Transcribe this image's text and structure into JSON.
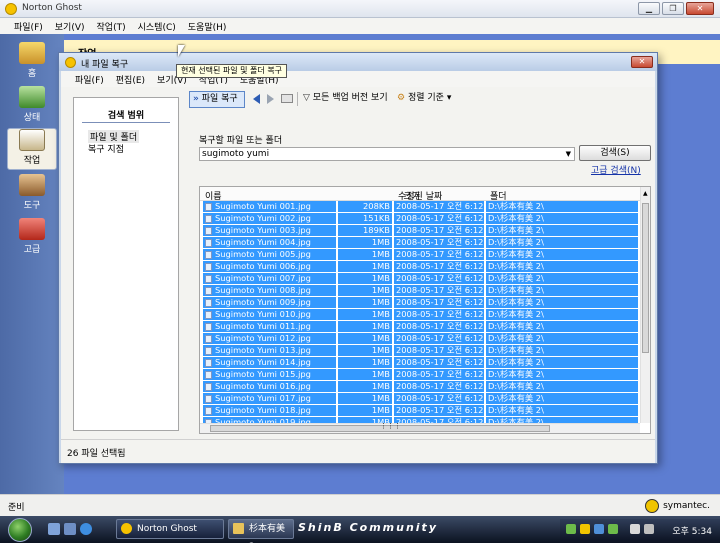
{
  "app": {
    "title": "Norton Ghost",
    "menu": [
      "파일(F)",
      "보기(V)",
      "작업(T)",
      "시스템(C)",
      "도움말(H)"
    ],
    "header_title": "작업",
    "status": "준비",
    "brand": "symantec."
  },
  "sidebar": {
    "items": [
      {
        "label": "홈",
        "icon": "home-icon",
        "active": false
      },
      {
        "label": "상태",
        "icon": "status-icon",
        "active": false
      },
      {
        "label": "작업",
        "icon": "tasks-icon",
        "active": true
      },
      {
        "label": "도구",
        "icon": "tools-icon",
        "active": false
      },
      {
        "label": "고급",
        "icon": "advanced-icon",
        "active": false
      }
    ]
  },
  "dialog": {
    "title": "내 파일 복구",
    "menu": [
      "파일(F)",
      "편집(E)",
      "보기(V)",
      "작업(T)",
      "도움말(H)"
    ],
    "toolbar": {
      "restore": "파일 복구",
      "all_versions": "모든 백업 버전 보기",
      "sort": "정렬 기준"
    },
    "tooltip": "현재 선택된 파일 및 폴더 복구",
    "search_scope": {
      "title": "검색 범위",
      "options": [
        "파일 및 폴더",
        "복구 지점"
      ]
    },
    "search": {
      "label": "복구할 파일 또는 폴더",
      "value": "sugimoto yumi",
      "button": "검색(S)",
      "advanced": "고급 검색(N)"
    },
    "columns": [
      "이름",
      "크기",
      "수정된 날짜",
      "폴더"
    ],
    "rows": [
      {
        "name": "Sugimoto Yumi 001.jpg",
        "size": "208KB",
        "date": "2008-05-17 오전 6:12",
        "folder": "D:\\杉本有美 2\\"
      },
      {
        "name": "Sugimoto Yumi 002.jpg",
        "size": "151KB",
        "date": "2008-05-17 오전 6:12",
        "folder": "D:\\杉本有美 2\\"
      },
      {
        "name": "Sugimoto Yumi 003.jpg",
        "size": "189KB",
        "date": "2008-05-17 오전 6:12",
        "folder": "D:\\杉本有美 2\\"
      },
      {
        "name": "Sugimoto Yumi 004.jpg",
        "size": "1MB",
        "date": "2008-05-17 오전 6:12",
        "folder": "D:\\杉本有美 2\\"
      },
      {
        "name": "Sugimoto Yumi 005.jpg",
        "size": "1MB",
        "date": "2008-05-17 오전 6:12",
        "folder": "D:\\杉本有美 2\\"
      },
      {
        "name": "Sugimoto Yumi 006.jpg",
        "size": "1MB",
        "date": "2008-05-17 오전 6:12",
        "folder": "D:\\杉本有美 2\\"
      },
      {
        "name": "Sugimoto Yumi 007.jpg",
        "size": "1MB",
        "date": "2008-05-17 오전 6:12",
        "folder": "D:\\杉本有美 2\\"
      },
      {
        "name": "Sugimoto Yumi 008.jpg",
        "size": "1MB",
        "date": "2008-05-17 오전 6:12",
        "folder": "D:\\杉本有美 2\\"
      },
      {
        "name": "Sugimoto Yumi 009.jpg",
        "size": "1MB",
        "date": "2008-05-17 오전 6:12",
        "folder": "D:\\杉本有美 2\\"
      },
      {
        "name": "Sugimoto Yumi 010.jpg",
        "size": "1MB",
        "date": "2008-05-17 오전 6:12",
        "folder": "D:\\杉本有美 2\\"
      },
      {
        "name": "Sugimoto Yumi 011.jpg",
        "size": "1MB",
        "date": "2008-05-17 오전 6:12",
        "folder": "D:\\杉本有美 2\\"
      },
      {
        "name": "Sugimoto Yumi 012.jpg",
        "size": "1MB",
        "date": "2008-05-17 오전 6:12",
        "folder": "D:\\杉本有美 2\\"
      },
      {
        "name": "Sugimoto Yumi 013.jpg",
        "size": "1MB",
        "date": "2008-05-17 오전 6:12",
        "folder": "D:\\杉本有美 2\\"
      },
      {
        "name": "Sugimoto Yumi 014.jpg",
        "size": "1MB",
        "date": "2008-05-17 오전 6:12",
        "folder": "D:\\杉本有美 2\\"
      },
      {
        "name": "Sugimoto Yumi 015.jpg",
        "size": "1MB",
        "date": "2008-05-17 오전 6:12",
        "folder": "D:\\杉本有美 2\\"
      },
      {
        "name": "Sugimoto Yumi 016.jpg",
        "size": "1MB",
        "date": "2008-05-17 오전 6:12",
        "folder": "D:\\杉本有美 2\\"
      },
      {
        "name": "Sugimoto Yumi 017.jpg",
        "size": "1MB",
        "date": "2008-05-17 오전 6:12",
        "folder": "D:\\杉本有美 2\\"
      },
      {
        "name": "Sugimoto Yumi 018.jpg",
        "size": "1MB",
        "date": "2008-05-17 오전 6:12",
        "folder": "D:\\杉本有美 2\\"
      },
      {
        "name": "Sugimoto Yumi 019.jpg",
        "size": "1MB",
        "date": "2008-05-17 오전 6:12",
        "folder": "D:\\杉本有美 2\\"
      },
      {
        "name": "Sugimoto Yumi 020.jpg",
        "size": "1MB",
        "date": "2008-05-17 오전 6:12",
        "folder": "D:\\杉本有美 2\\"
      }
    ],
    "status": "26 파일 선택됨"
  },
  "taskbar": {
    "tasks": [
      {
        "label": "Norton Ghost",
        "active": true
      },
      {
        "label": "杉本有美 2",
        "active": false
      }
    ],
    "banner": "ShinB Community",
    "clock": "오후 5:34"
  },
  "colors": {
    "selection": "#3399ff",
    "sidebar": "#4d6aa6",
    "content_bg": "#5d7dd1",
    "header_strip": "#fff4c2"
  }
}
